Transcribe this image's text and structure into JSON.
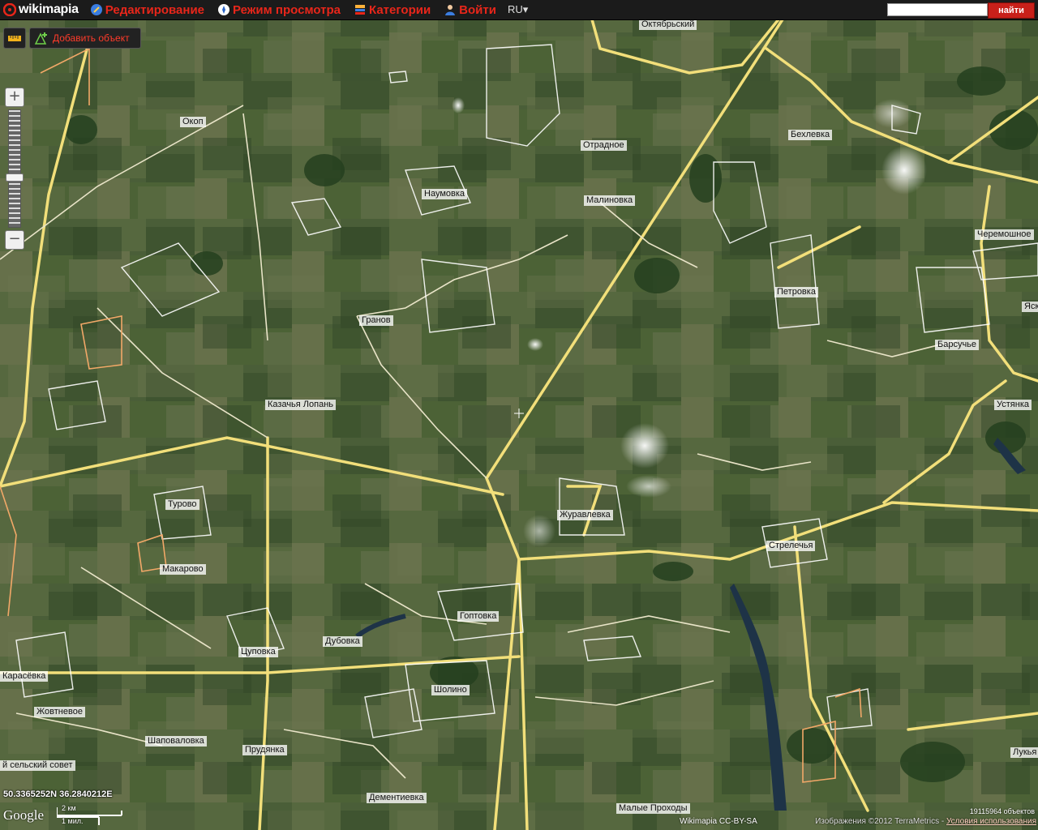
{
  "topbar": {
    "logo": "wikimapia",
    "nav": [
      {
        "label": "Редактирование",
        "icon": "edit-icon"
      },
      {
        "label": "Режим просмотра",
        "icon": "compass-icon"
      },
      {
        "label": "Категории",
        "icon": "categories-icon"
      },
      {
        "label": "Войти",
        "icon": "user-icon"
      }
    ],
    "lang": "RU",
    "search_placeholder": "",
    "search_button": "найти"
  },
  "toolbar": {
    "add_object": "Добавить объект"
  },
  "places": [
    "Октябрьский",
    "Окоп",
    "Бехлевка",
    "Отрадное",
    "Наумовка",
    "Малиновка",
    "Черемошное",
    "Петровка",
    "Гранов",
    "Барсучье",
    "Казачья Лопань",
    "Устянка",
    "Турово",
    "Журавлевка",
    "Стрелечья",
    "Макарово",
    "Гоптовка",
    "Цуповка",
    "Дубовка",
    "Карасёвка",
    "Шолино",
    "Жовтневое",
    "Шаповаловка",
    "Прудянка",
    "Дементиевка",
    "Малые Проходы",
    "Лукья",
    "Яск",
    "й сельский совет"
  ],
  "footer": {
    "coords": "50.3365252N 36.2840212E",
    "google": "Google",
    "scale_km": "2 км",
    "scale_mi": "1 мил.",
    "license": "Wikimapia CC-BY-SA",
    "imagery": "Изображения ©2012 TerraMetrics -",
    "terms": "Условия использования",
    "object_count": "19115964 объектов"
  },
  "colors": {
    "topbar_bg": "#1b1b1b",
    "nav_text": "#e8261a",
    "search_button": "#c8201a",
    "road_major": "#f2df7a",
    "road_minor": "#e9e4c8",
    "outline": "#ffffff",
    "outline_alt": "#f2a868",
    "water": "#1e3347"
  }
}
